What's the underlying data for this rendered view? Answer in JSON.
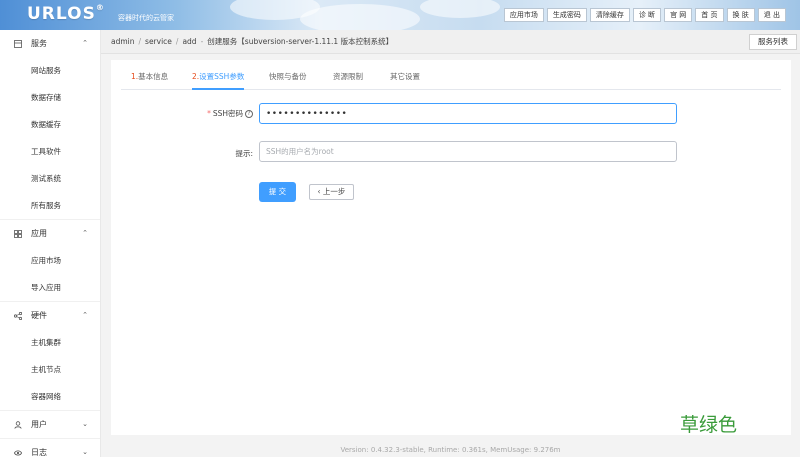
{
  "header": {
    "logo": "URLOS",
    "logo_mark": "®",
    "tagline": "容器时代的云管家",
    "nav": [
      "应用市场",
      "生成密码",
      "清除缓存",
      "诊 断",
      "官 网",
      "首 页",
      "换 肤",
      "退 出"
    ]
  },
  "sidebar": {
    "groups": [
      {
        "label": "服务",
        "icon": "server-icon",
        "expanded": true,
        "items": [
          "网站服务",
          "数据存储",
          "数据缓存",
          "工具软件",
          "测试系统",
          "所有服务"
        ]
      },
      {
        "label": "应用",
        "icon": "grid-icon",
        "expanded": true,
        "items": [
          "应用市场",
          "导入应用"
        ]
      },
      {
        "label": "硬件",
        "icon": "share-icon",
        "expanded": true,
        "items": [
          "主机集群",
          "主机节点",
          "容器网络"
        ]
      },
      {
        "label": "用户",
        "icon": "user-icon",
        "expanded": false,
        "items": []
      },
      {
        "label": "日志",
        "icon": "eye-icon",
        "expanded": false,
        "items": []
      }
    ]
  },
  "breadcrumb": {
    "items": [
      "admin",
      "service",
      "add",
      "创建服务【subversion-server-1.11.1 版本控制系统】"
    ],
    "service_list_button": "服务列表"
  },
  "tabs": [
    {
      "num": "1.",
      "label": "基本信息"
    },
    {
      "num": "2.",
      "label": "设置SSH参数"
    },
    {
      "num": "",
      "label": "快照与备份"
    },
    {
      "num": "",
      "label": "资源限制"
    },
    {
      "num": "",
      "label": "其它设置"
    }
  ],
  "active_tab": 1,
  "form": {
    "ssh_password": {
      "required": "*",
      "label": "SSH密码",
      "help": "?",
      "value": "••••••••••••••"
    },
    "tip": {
      "label": "提示:",
      "placeholder": "SSH的用户名为root"
    },
    "submit": "提 交",
    "prev": "‹ 上一步"
  },
  "footer": "Version: 0.4.32.3-stable,   Runtime: 0.361s,   MemUsage: 9.276m",
  "watermark": "草绿色",
  "colors": {
    "primary": "#409eff",
    "tab_number": "#e64a19",
    "watermark": "#3a9b3a"
  }
}
